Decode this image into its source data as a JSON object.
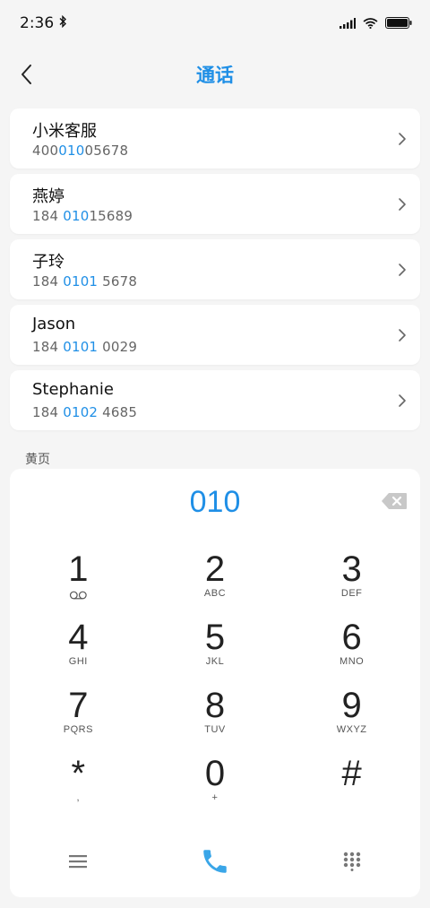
{
  "status": {
    "time": "2:36",
    "icons": [
      "bluetooth-icon",
      "signal-icon",
      "wifi-icon",
      "battery-icon"
    ]
  },
  "header": {
    "title": "通话"
  },
  "contacts": [
    {
      "name": "小米客服",
      "number_pre": "400",
      "number_hl": "010",
      "number_post": "05678"
    },
    {
      "name": "燕婷",
      "number_pre": "184 ",
      "number_hl": "010",
      "number_post": "15689"
    },
    {
      "name": "子玲",
      "number_pre": "184 ",
      "number_hl": "0101",
      "number_post": " 5678"
    },
    {
      "name": "Jason",
      "number_pre": "184 ",
      "number_hl": "0101",
      "number_post": " 0029"
    },
    {
      "name": "Stephanie",
      "number_pre": "184 ",
      "number_hl": "0102",
      "number_post": " 4685"
    }
  ],
  "section_label": "黄页",
  "dialpad": {
    "display": "010",
    "keys": [
      {
        "digit": "1",
        "sub": ""
      },
      {
        "digit": "2",
        "sub": "ABC"
      },
      {
        "digit": "3",
        "sub": "DEF"
      },
      {
        "digit": "4",
        "sub": "GHI"
      },
      {
        "digit": "5",
        "sub": "JKL"
      },
      {
        "digit": "6",
        "sub": "MNO"
      },
      {
        "digit": "7",
        "sub": "PQRS"
      },
      {
        "digit": "8",
        "sub": "TUV"
      },
      {
        "digit": "9",
        "sub": "WXYZ"
      },
      {
        "digit": "*",
        "sub": ","
      },
      {
        "digit": "0",
        "sub": "+"
      },
      {
        "digit": "#",
        "sub": ""
      }
    ]
  },
  "colors": {
    "accent": "#1f8fe6",
    "call_button": "#3aa6e8"
  }
}
